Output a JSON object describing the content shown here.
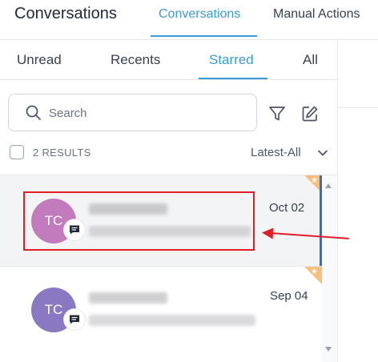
{
  "header": {
    "app_title": "Conversations",
    "tabs": [
      {
        "label": "Conversations",
        "active": true
      },
      {
        "label": "Manual Actions",
        "active": false
      }
    ]
  },
  "subtabs": [
    {
      "label": "Unread",
      "active": false
    },
    {
      "label": "Recents",
      "active": false
    },
    {
      "label": "Starred",
      "active": true
    },
    {
      "label": "All",
      "active": false
    }
  ],
  "search": {
    "placeholder": "Search",
    "value": ""
  },
  "toolbar": {
    "filter_icon": "filter-icon",
    "compose_icon": "compose-icon"
  },
  "results": {
    "count_label": "2 RESULTS",
    "sort_label": "Latest-All"
  },
  "conversations": [
    {
      "initials": "TC",
      "avatar_color": "#c27bbd",
      "date": "Oct 02",
      "starred": true,
      "selected": true
    },
    {
      "initials": "TC",
      "avatar_color": "#8a78c2",
      "date": "Sep 04",
      "starred": true,
      "selected": false
    }
  ],
  "colors": {
    "accent": "#3b9ad6",
    "annotation": "#e11d2a",
    "star_corner": "#fbbf7c",
    "scroll_thumb": "#2f6fd3"
  }
}
